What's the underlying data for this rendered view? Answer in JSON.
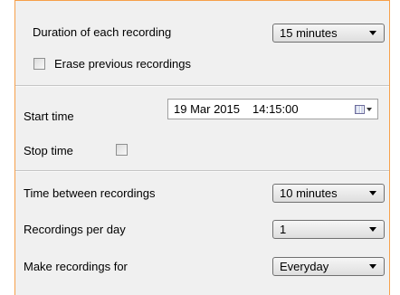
{
  "duration": {
    "label": "Duration of each recording",
    "value": "15 minutes"
  },
  "erase": {
    "label": "Erase previous recordings",
    "checked": false
  },
  "start": {
    "label": "Start time",
    "date": "19 Mar 2015",
    "time": "14:15:00"
  },
  "stop": {
    "label": "Stop time",
    "checked": false
  },
  "between": {
    "label": "Time between recordings",
    "value": "10 minutes"
  },
  "per_day": {
    "label": "Recordings per day",
    "value": "1"
  },
  "make_for": {
    "label": "Make recordings for",
    "value": "Everyday"
  }
}
